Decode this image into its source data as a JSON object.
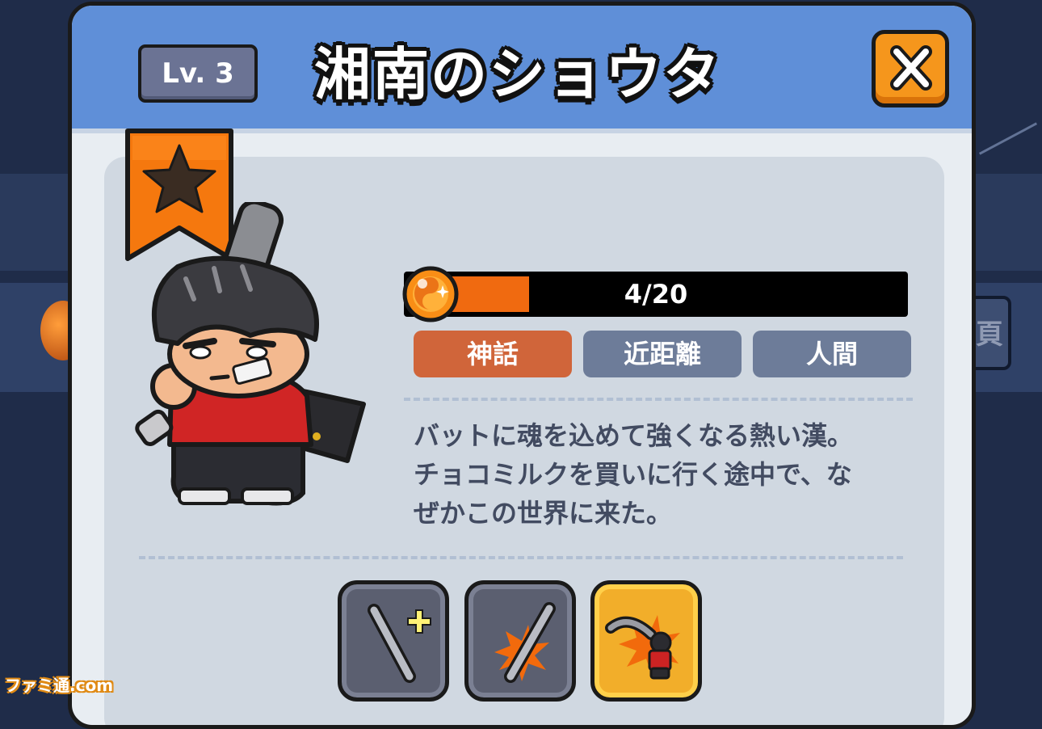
{
  "header": {
    "level": "Lv. 3",
    "title": "湘南のショウタ",
    "close_icon": "close-x-icon"
  },
  "character": {
    "rank_icon": "star-icon",
    "portrait": "shouta-character"
  },
  "progress": {
    "label": "4/20",
    "current": 4,
    "max": 20,
    "icon": "dragon-orb-icon"
  },
  "tags": {
    "rarity": "神話",
    "range": "近距離",
    "race": "人間"
  },
  "description": {
    "line1": "バットに魂を込めて強くなる熱い漢。",
    "line2": "チョコミルクを買いに行く途中で、な",
    "line3": "ぜかこの世界に来た。"
  },
  "skills": [
    {
      "icon": "bat-plus-icon"
    },
    {
      "icon": "bat-burst-icon"
    },
    {
      "icon": "swing-attack-icon"
    }
  ],
  "watermark": "ファミ通.com",
  "colors": {
    "header_blue": "#5f8fd8",
    "close_orange": "#f5961c",
    "rarity_tag": "#d0653a",
    "tag_gray": "#6d7c99",
    "progress_fill": "#f06a10"
  }
}
